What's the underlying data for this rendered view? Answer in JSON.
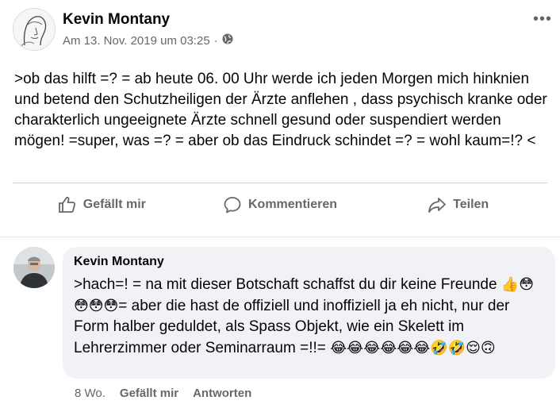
{
  "post": {
    "author": "Kevin Montany",
    "date": "Am 13. Nov. 2019 um 03:25",
    "separator": "·",
    "more": "•••",
    "text": ">ob das hilft =? = ab heute 06. 00 Uhr werde ich jeden Morgen mich hinknien und betend den Schutzheiligen der Ärzte anflehen , dass psychisch kranke oder charakterlich ungeeignete Ärzte schnell gesund oder suspendiert werden mögen! =super, was =? = aber ob das Eindruck schindet =? = wohl kaum=!? <"
  },
  "actions": {
    "like": "Gefällt mir",
    "comment": "Kommentieren",
    "share": "Teilen"
  },
  "comment": {
    "author": "Kevin Montany",
    "text_part1": ">hach=! = na mit dieser Botschaft schaffst du dir keine Freunde ",
    "emojis1": "👍😳😳😳😳",
    "text_part2": "= aber die hast de offiziell und inoffiziell ja  eh nicht, nur der Form  halber geduldet, als Spass Objekt, wie ein Skelett im Lehrerzimmer oder Seminarraum =!!= ",
    "emojis2": "😂😂😂😂😂😂🤣🤣😌🙃",
    "age": "8 Wo.",
    "like": "Gefällt mir",
    "reply": "Antworten"
  },
  "colors": {
    "secondary_text": "#65676b",
    "bubble": "#f0f2f5",
    "divider": "#ced0d4"
  }
}
